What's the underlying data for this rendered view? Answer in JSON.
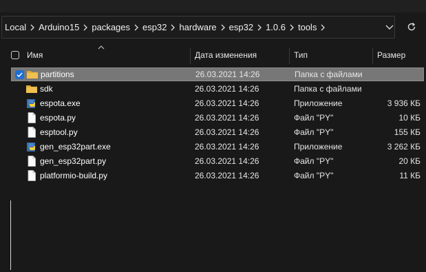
{
  "breadcrumb": [
    "Local",
    "Arduino15",
    "packages",
    "esp32",
    "hardware",
    "esp32",
    "1.0.6",
    "tools"
  ],
  "columns": {
    "name": "Имя",
    "date": "Дата изменения",
    "type": "Тип",
    "size": "Размер"
  },
  "files": [
    {
      "name": "partitions",
      "date": "26.03.2021 14:26",
      "type": "Папка с файлами",
      "size": "",
      "icon": "folder-icon",
      "selected": true
    },
    {
      "name": "sdk",
      "date": "26.03.2021 14:26",
      "type": "Папка с файлами",
      "size": "",
      "icon": "folder-icon",
      "selected": false
    },
    {
      "name": "espota.exe",
      "date": "26.03.2021 14:26",
      "type": "Приложение",
      "size": "3 936 КБ",
      "icon": "python-exe-icon",
      "selected": false
    },
    {
      "name": "espota.py",
      "date": "26.03.2021 14:26",
      "type": "Файл \"PY\"",
      "size": "10 КБ",
      "icon": "document-icon",
      "selected": false
    },
    {
      "name": "esptool.py",
      "date": "26.03.2021 14:26",
      "type": "Файл \"PY\"",
      "size": "155 КБ",
      "icon": "document-icon",
      "selected": false
    },
    {
      "name": "gen_esp32part.exe",
      "date": "26.03.2021 14:26",
      "type": "Приложение",
      "size": "3 262 КБ",
      "icon": "python-exe-icon",
      "selected": false
    },
    {
      "name": "gen_esp32part.py",
      "date": "26.03.2021 14:26",
      "type": "Файл \"PY\"",
      "size": "20 КБ",
      "icon": "document-icon",
      "selected": false
    },
    {
      "name": "platformio-build.py",
      "date": "26.03.2021 14:26",
      "type": "Файл \"PY\"",
      "size": "11 КБ",
      "icon": "document-icon",
      "selected": false
    }
  ],
  "colors": {
    "background": "#191919",
    "selection": "#777777",
    "checkbox_accent": "#1f6fd1",
    "folder": "#e8b64a"
  }
}
